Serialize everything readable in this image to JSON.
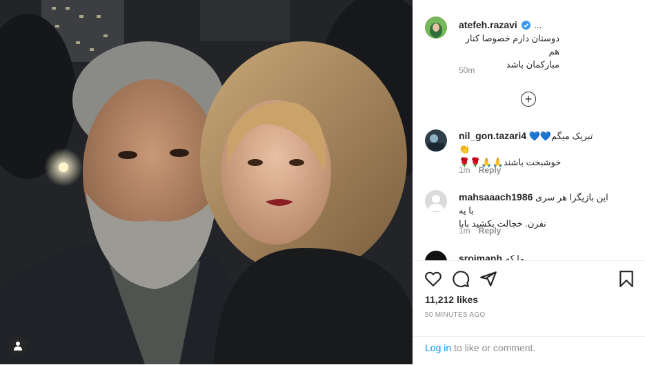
{
  "post": {
    "author": "atefeh.razavi",
    "more": "...",
    "caption_line1": "دوستان دارم خصوصا کنار هم",
    "caption_line2": "مبارکمان باشد",
    "caption_time": "50m"
  },
  "comments": [
    {
      "user": "nil_gon.tazari4",
      "line1": "تبریک میگم💙💙👏",
      "line2": "خوشبخت باشند🙏🙏🌹🌹",
      "time": "1m",
      "reply": "Reply"
    },
    {
      "user": "mahsaaach1986",
      "line1": "این بازیگرا هر سری با یه",
      "line2": "نفرن. خجالت بکشید بابا",
      "time": "1m",
      "reply": "Reply"
    },
    {
      "user": "sroimanh",
      "line1": "ما که"
    }
  ],
  "likes": "11,212 likes",
  "time_ago": "50 MINUTES AGO",
  "login": {
    "link": "Log in",
    "rest": "to like or comment."
  },
  "colors": {
    "link_blue": "#0095f6",
    "verified_blue": "#3897f0",
    "muted": "#8e8e8e",
    "text": "#262626"
  }
}
